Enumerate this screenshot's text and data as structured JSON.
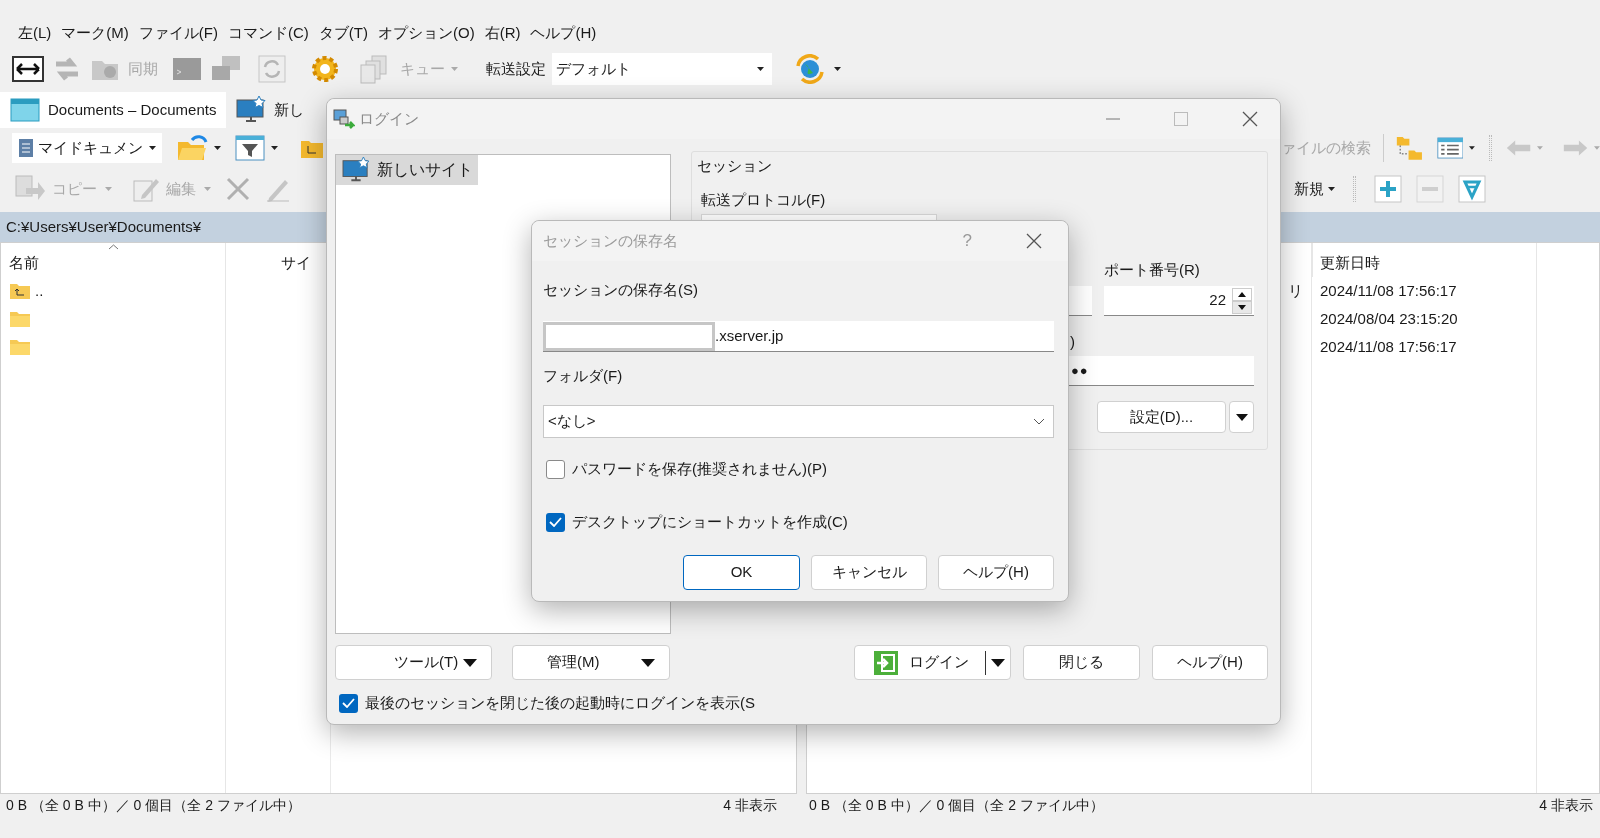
{
  "menu_bar": [
    "左(L)",
    "マーク(M)",
    "ファイル(F)",
    "コマンド(C)",
    "タブ(T)",
    "オプション(O)",
    "右(R)",
    "ヘルプ(H)"
  ],
  "toolbar": {
    "sync_label": "同期",
    "queue_label": "キュー",
    "transfer_settings_label": "転送設定",
    "transfer_settings_value": "デフォルト"
  },
  "tabs": [
    {
      "kind": "local",
      "label": "Documents – Documents",
      "selected": true
    },
    {
      "kind": "site",
      "label": "新し",
      "selected": false
    }
  ],
  "left_panel": {
    "location": "マイドキュメン",
    "copy_button": "コピー",
    "edit_button": "編集",
    "path": "C:¥Users¥User¥Documents¥",
    "columns": [
      "名前",
      "サイ"
    ],
    "rows": [
      {
        "kind": "parent",
        "name": ".."
      },
      {
        "kind": "folder"
      },
      {
        "kind": "folder"
      }
    ],
    "status": "0 B （全 0 B 中）／ 0 個目（全 2 ファイル中）",
    "hidden_count": "4 非表示"
  },
  "right_panel": {
    "find_files": "ァイルの検索",
    "new_button": "新規",
    "columns": [
      "更新日時"
    ],
    "rows": [
      {
        "column_3": "リ",
        "modified": "2024/11/08 17:56:17"
      },
      {
        "modified": "2024/08/04 23:15:20"
      },
      {
        "modified": "2024/11/08 17:56:17"
      }
    ],
    "status": "0 B （全 0 B 中）／ 0 個目（全 2 ファイル中）",
    "hidden_count": "4 非表示"
  },
  "login_dialog": {
    "title": "ログイン",
    "sites": [
      {
        "label": "新しいサイト",
        "selected": true
      }
    ],
    "session_group": "セッション",
    "protocol_label": "転送プロトコル(F)",
    "port_label": "ポート番号(R)",
    "port": "22",
    "password_label": ")",
    "password": "●●",
    "settings_button": "設定(D)...",
    "tools_button": "ツール(T)",
    "manage_button": "管理(M)",
    "login_button": "ログイン",
    "close_button": "閉じる",
    "help_button": "ヘルプ(H)",
    "show_login": {
      "label": "最後のセッションを閉じた後の起動時にログインを表示(S",
      "checked": true
    }
  },
  "save_dialog": {
    "title": "セッションの保存名",
    "help_mark": "?",
    "name_label": "セッションの保存名(S)",
    "name_value": ".xserver.jp",
    "folder_label": "フォルダ(F)",
    "folder_value": "<なし>",
    "options": [
      {
        "label": "パスワードを保存(推奨されません)(P)",
        "checked": false
      },
      {
        "label": "デスクトップにショートカットを作成(C)",
        "checked": true
      }
    ],
    "buttons": [
      {
        "label": "OK",
        "default": true
      },
      {
        "label": "キャンセル",
        "default": false
      },
      {
        "label": "ヘルプ(H)",
        "default": false
      }
    ]
  }
}
